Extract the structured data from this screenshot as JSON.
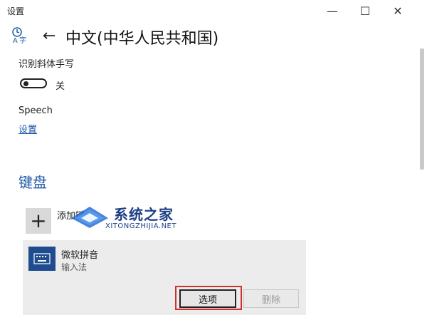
{
  "window": {
    "title": "设置",
    "controls": {
      "minimize": "—",
      "maximize": "☐",
      "close": "✕"
    }
  },
  "header": {
    "icon": "language-icon",
    "back_icon": "back-arrow-icon",
    "back_glyph": "←",
    "title": "中文(中华人民共和国)"
  },
  "handwriting": {
    "label": "识别斜体手写",
    "toggle_state": "off",
    "toggle_text": "关"
  },
  "speech": {
    "label": "Speech",
    "link": "设置"
  },
  "keyboards": {
    "heading": "键盘",
    "add_glyph": "+",
    "add_label": "添加键盘",
    "items": [
      {
        "name": "微软拼音",
        "type": "输入法",
        "icon": "keyboard-icon",
        "buttons": {
          "options": "选项",
          "remove": "删除"
        }
      }
    ]
  },
  "watermark": {
    "brand": "系统之家",
    "url": "XITONGZHIJIA.NET"
  },
  "colors": {
    "accent": "#1f5aa6",
    "highlight": "#d32f2f",
    "keyboard_icon_bg": "#1e4c8f"
  }
}
